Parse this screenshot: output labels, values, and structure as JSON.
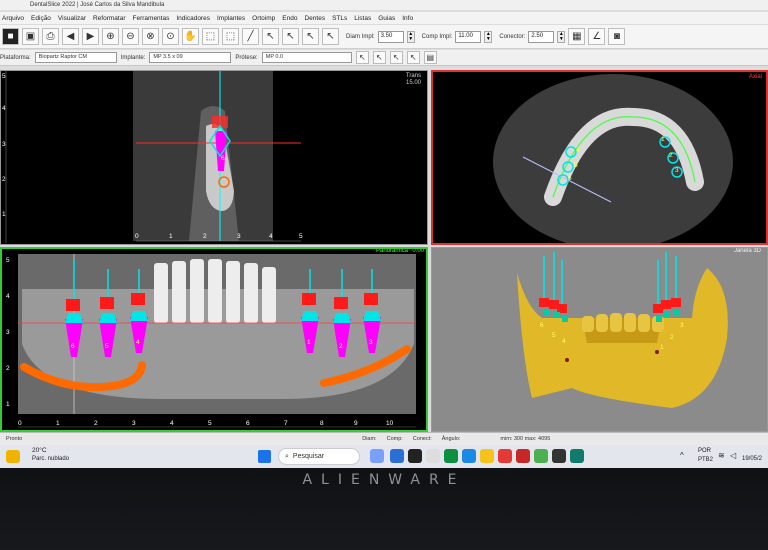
{
  "window": {
    "title": "DentalSlice 2022 | José Carlos da Silva Mandibula"
  },
  "menu": [
    "Arquivo",
    "Edição",
    "Visualizar",
    "Reformatar",
    "Ferramentas",
    "Indicadores",
    "Implantes",
    "Ortoimp",
    "Endo",
    "Dentes",
    "STLs",
    "Listas",
    "Guias",
    "Info"
  ],
  "toolbar": {
    "diam_label": "Diam Impl:",
    "diam_value": "3.50",
    "comp_label": "Comp Impl:",
    "comp_value": "11.00",
    "conector_label": "Conector:",
    "conector_value": "2.50"
  },
  "toolbar2": {
    "plataforma_label": "Plataforma:",
    "plataforma_value": "Biopartz Raptor CM",
    "implante_label": "Implante:",
    "implante_value": "MP 3.5 x 09",
    "protese_label": "Prótese:",
    "protese_value": "MP 0.0"
  },
  "panes": {
    "trans": {
      "label": "Trans",
      "value": "15.00",
      "ticks_y": [
        "5",
        "4",
        "3",
        "2",
        "1"
      ],
      "ticks_x": [
        "0",
        "1",
        "2",
        "3",
        "4",
        "5"
      ],
      "marker": "6"
    },
    "axial": {
      "label": "Axial",
      "markers": [
        "4",
        "5",
        "6",
        "1",
        "2",
        "3"
      ]
    },
    "panoramica": {
      "label": "Panorâmica",
      "value": "0.00",
      "ticks_y": [
        "5",
        "4",
        "3",
        "2",
        "1"
      ],
      "ticks_x": [
        "0",
        "1",
        "2",
        "3",
        "4",
        "5",
        "6",
        "7",
        "8",
        "9",
        "10"
      ],
      "left_markers": [
        "6",
        "5",
        "4"
      ],
      "right_markers": [
        "1",
        "2",
        "3"
      ]
    },
    "janela3d": {
      "label": "Janela 3D",
      "markers": [
        "6",
        "5",
        "4",
        "1",
        "2",
        "3"
      ]
    }
  },
  "statusbar": {
    "pronto": "Pronto",
    "diam": "Diam:",
    "comp": "Comp:",
    "conect": "Conect:",
    "angulo": "Ângulo:",
    "minmax": "mim: 300  max: 4095"
  },
  "taskbar": {
    "temp": "20°C",
    "weather": "Parc. nublado",
    "search": "Pesquisar",
    "lang1": "POR",
    "lang2": "PTB2",
    "date": "19/05/2"
  },
  "bezel": {
    "brand": "ALIENWARE"
  },
  "colors": {
    "implant": "#ff00ff",
    "abutment": "#00e5e5",
    "nerve": "#ff6a00",
    "marker": "#ff0000",
    "bone3d": "#e0b828"
  }
}
